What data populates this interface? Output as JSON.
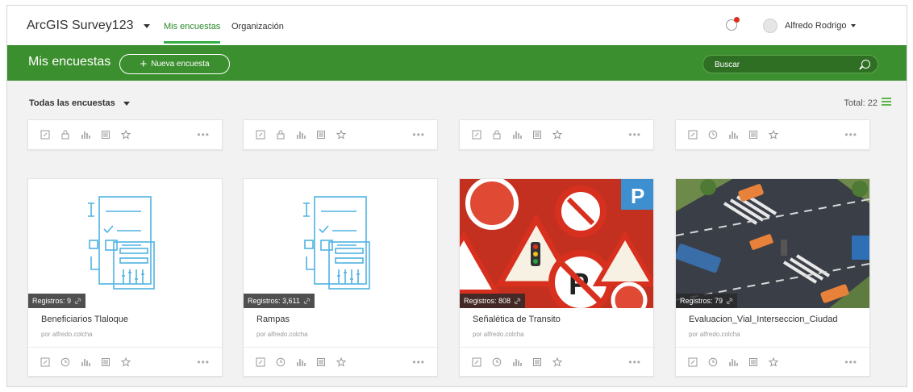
{
  "header": {
    "app_title": "ArcGIS Survey123",
    "nav": [
      {
        "label": "Mis encuestas",
        "active": true
      },
      {
        "label": "Organización",
        "active": false
      }
    ],
    "user_name": "Alfredo Rodrigo",
    "notification_icon": "notification-icon"
  },
  "toolbar": {
    "page_title": "Mis encuestas",
    "new_survey_label": "Nueva encuesta",
    "search_placeholder": "Buscar"
  },
  "filter": {
    "label": "Todas las encuestas",
    "total": "Total: 22"
  },
  "colors": {
    "brand_green": "#3c8f2f",
    "active_nav": "#35ac46",
    "thumb_icon": "#4fb3e3"
  },
  "top_cards": [
    {
      "icons": [
        "edit-icon",
        "lock-icon",
        "analyze-icon",
        "data-icon",
        "favorite-icon"
      ]
    },
    {
      "icons": [
        "edit-icon",
        "lock-icon",
        "analyze-icon",
        "data-icon",
        "favorite-icon"
      ]
    },
    {
      "icons": [
        "edit-icon",
        "lock-icon",
        "analyze-icon",
        "data-icon",
        "favorite-icon"
      ]
    },
    {
      "icons": [
        "edit-icon",
        "clock-icon",
        "analyze-icon",
        "data-icon",
        "favorite-icon"
      ]
    }
  ],
  "cards": [
    {
      "records": "Registros: 9",
      "title": "Beneficiarios Tlaloque",
      "owner": "por alfredo.colcha",
      "thumbnail": "form-illustration"
    },
    {
      "records": "Registros: 3,611",
      "title": "Rampas",
      "owner": "por alfredo.colcha",
      "thumbnail": "form-illustration"
    },
    {
      "records": "Registros: 808",
      "title": "Señalética de Transito",
      "owner": "por alfredo.colcha",
      "thumbnail": "traffic-signs-photo"
    },
    {
      "records": "Registros: 79",
      "title": "Evaluacion_Vial_Interseccion_Ciudad",
      "owner": "por alfredo.colcha",
      "thumbnail": "intersection-illustration"
    }
  ],
  "more_label": "•••"
}
